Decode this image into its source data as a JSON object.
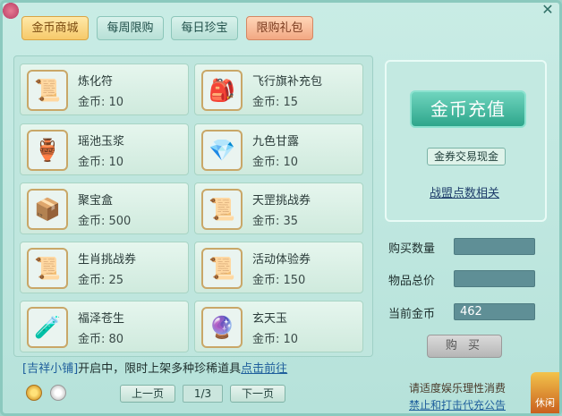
{
  "tabs": [
    {
      "label": "金币商城"
    },
    {
      "label": "每周限购"
    },
    {
      "label": "每日珍宝"
    },
    {
      "label": "限购礼包"
    }
  ],
  "items": [
    {
      "name": "炼化符",
      "price": "金币: 10",
      "icon": "talisman-icon",
      "glyph": "📜"
    },
    {
      "name": "飞行旗补充包",
      "price": "金币: 15",
      "icon": "flag-pouch-icon",
      "glyph": "🎒"
    },
    {
      "name": "瑶池玉浆",
      "price": "金币: 10",
      "icon": "jade-potion-icon",
      "glyph": "🏺"
    },
    {
      "name": "九色甘露",
      "price": "金币: 10",
      "icon": "gem-dew-icon",
      "glyph": "💎"
    },
    {
      "name": "聚宝盒",
      "price": "金币: 500",
      "icon": "treasure-box-icon",
      "glyph": "📦"
    },
    {
      "name": "天罡挑战券",
      "price": "金币: 35",
      "icon": "scroll-icon",
      "glyph": "📜"
    },
    {
      "name": "生肖挑战券",
      "price": "金币: 25",
      "icon": "scroll-icon",
      "glyph": "📜"
    },
    {
      "name": "活动体验券",
      "price": "金币: 150",
      "icon": "scroll-icon",
      "glyph": "📜"
    },
    {
      "name": "福泽苍生",
      "price": "金币: 80",
      "icon": "potion-bottle-icon",
      "glyph": "🧪"
    },
    {
      "name": "玄天玉",
      "price": "金币: 10",
      "icon": "jade-gem-icon",
      "glyph": "🔮"
    }
  ],
  "right": {
    "recharge_label": "金币充值",
    "exchange_label": "金券交易现金",
    "alliance_label": "战盟点数相关",
    "qty_label": "购买数量",
    "total_label": "物品总价",
    "current_label": "当前金币",
    "qty_value": "",
    "total_value": "",
    "current_value": "462",
    "buy_label": "购 买"
  },
  "notice": {
    "shop": "[吉祥小铺]",
    "text": "开启中，限时上架多种珍稀道具",
    "goto": "点击前往"
  },
  "pager": {
    "prev": "上一页",
    "indicator": "1/3",
    "next": "下一页"
  },
  "footer": {
    "line1": "请适度娱乐理性消费",
    "line2": "禁止和打击代充公告"
  },
  "activity_label": "休闲"
}
